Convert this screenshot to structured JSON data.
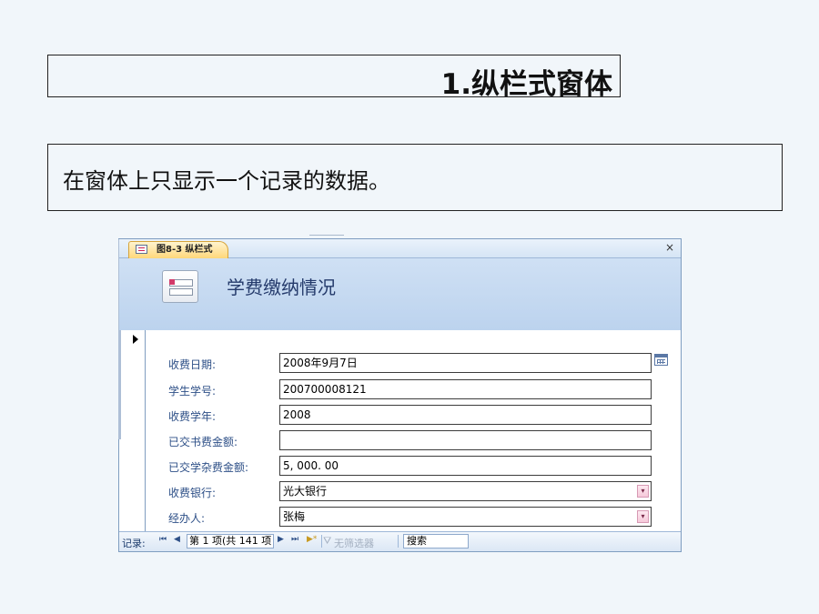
{
  "slide": {
    "title": "1.纵栏式窗体",
    "description": "在窗体上只显示一个记录的数据。"
  },
  "window": {
    "tab_label": "图8-3 纵栏式",
    "close_glyph": "×",
    "header_title": "学费缴纳情况",
    "fields": [
      {
        "label": "收费日期:",
        "value": "2008年9月7日"
      },
      {
        "label": "学生学号:",
        "value": "200700008121"
      },
      {
        "label": "收费学年:",
        "value": "2008"
      },
      {
        "label": "已交书费金额:",
        "value": ""
      },
      {
        "label": "已交学杂费金额:",
        "value": "5, 000. 00"
      },
      {
        "label": "收费银行:",
        "value": "光大银行",
        "dropdown": true
      },
      {
        "label": "经办人:",
        "value": "张梅",
        "dropdown": true
      }
    ],
    "dropdown_glyph": "▾",
    "navigation": {
      "records_label": "记录:",
      "first": "⏮",
      "prev": "◀",
      "record_text": "第 1 项(共 141 项",
      "next": "▶",
      "last": "⏭",
      "new": "▶*",
      "filter_label": "无筛选器",
      "search_text": "搜索"
    }
  },
  "icons": {
    "form-icon": "form",
    "calendar-icon": "calendar",
    "record-selector-icon": "triangle-right"
  }
}
